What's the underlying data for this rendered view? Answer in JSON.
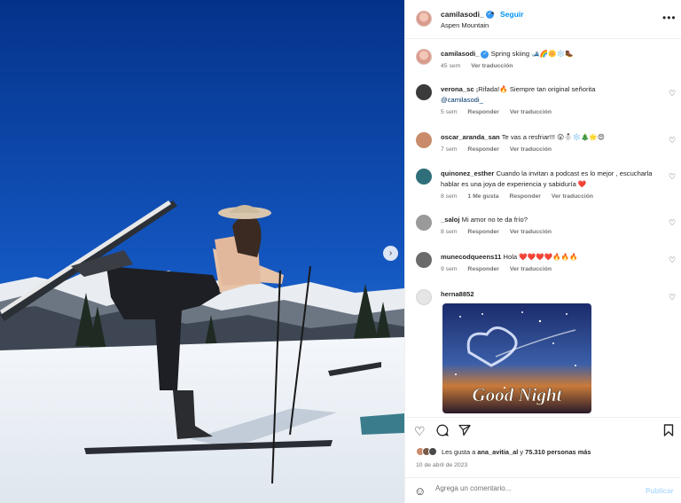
{
  "post": {
    "username": "camilasodi_",
    "follow_label": "Seguir",
    "location": "Aspen Mountain",
    "more_icon": "more-horizontal-icon"
  },
  "caption": {
    "username": "camilasodi_",
    "text": "Spring skiing 🎿🌈🌼❄️🥾",
    "time": "45 sem",
    "translate": "Ver traducción"
  },
  "comments": [
    {
      "username": "verona_sc",
      "text": "¡Rifada!🔥 Siempre tan original señorita",
      "mention": "@camilasodi_",
      "time": "5 sem",
      "likes": "",
      "reply": "Responder",
      "translate": "Ver traducción",
      "avatar_color": "#3b3b3b"
    },
    {
      "username": "oscar_aranda_san",
      "text": "Te vas a resfriar!!! 😮⛄❄️🎄🌟😍",
      "time": "7 sem",
      "likes": "",
      "reply": "Responder",
      "translate": "Ver traducción",
      "avatar_color": "#c98b6a"
    },
    {
      "username": "quinonez_esther",
      "text": "Cuando la invitan a podcast es lo mejor , escucharla hablar es una joya de experiencia y sabiduría ❤️",
      "time": "8 sem",
      "likes": "1 Me gusta",
      "reply": "Responder",
      "translate": "Ver traducción",
      "avatar_color": "#2f6f7a"
    },
    {
      "username": "_saloj",
      "text": "Mi amor no te da frío?",
      "time": "8 sem",
      "likes": "",
      "reply": "Responder",
      "translate": "Ver traducción",
      "avatar_color": "#9a9a9a"
    },
    {
      "username": "munecodqueens11",
      "text": "Hola ❤️❤️❤️❤️🔥🔥🔥",
      "time": "9 sem",
      "likes": "",
      "reply": "Responder",
      "translate": "Ver traducción",
      "avatar_color": "#6b6b6b"
    },
    {
      "username": "herna8852",
      "text": "",
      "gif_text": "Good Night",
      "avatar_color": "#e5e5e5"
    }
  ],
  "actions": {
    "like_icon": "heart-icon",
    "comment_icon": "comment-icon",
    "share_icon": "share-icon",
    "save_icon": "bookmark-icon"
  },
  "likes": {
    "prefix": "Les gusta a",
    "user": "ana_avitia_al",
    "middle": "y",
    "count": "75.310 personas más"
  },
  "date": "10 de abril de 2023",
  "add_comment": {
    "placeholder": "Agrega un comentario...",
    "publish_label": "Publicar",
    "emoji_icon": "emoji-icon"
  },
  "colors": {
    "accent": "#0095f6",
    "verified": "#3797f0",
    "muted": "#737373",
    "publish_disabled": "#b3dbff"
  }
}
